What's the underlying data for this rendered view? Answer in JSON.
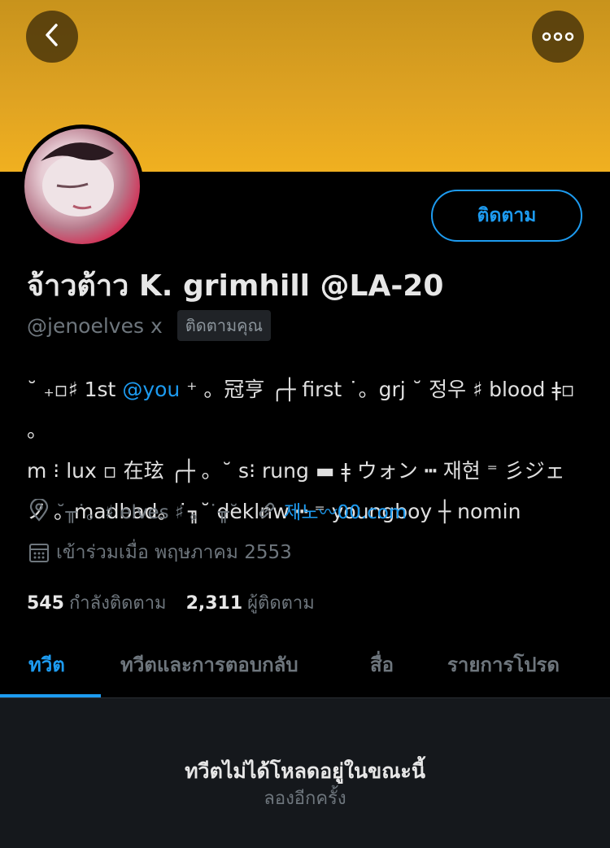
{
  "header": {
    "back_icon": "chevron-left-icon",
    "more_icon": "more-horizontal-icon",
    "banner_color": "#dea222"
  },
  "profile": {
    "follow_label": "ติดตาม",
    "display_name": "จ้าวต้าว K. grimhill @LA-20",
    "handle": "@jenoelves x",
    "follows_you": "ติดตามคุณ",
    "bio": {
      "line1_pre": "˘ ₊▫︎♯ 1st ",
      "line1_mention": "@you",
      "line1_post": " ⁺ 。冠亨 ╭┼ first ˙。grj ˘ 정우 ♯ blood ǂ▫︎ 。",
      "line2": "m ⁝ lux ▫︎ 在玹 ╭┼ 。˘ s⁝ rung ▬ ǂ ウォン ┅ 재현 ⁼ 彡ジェ",
      "line3": "ノ 。madbad。˙╖˘ deklnw ┅ ⁼ youngboy ┼ nomin"
    },
    "location": "˘╥˙。♯ elves ♯ 。˙╥˘",
    "website": "제노〰00.com",
    "joined": "เข้าร่วมเมื่อ พฤษภาคม 2553",
    "following_count": "545",
    "following_label": "กำลังติดตาม",
    "followers_count": "2,311",
    "followers_label": "ผู้ติดตาม",
    "accent_color": "#1d9bf0"
  },
  "tabs": [
    {
      "label": "ทวีต",
      "active": true
    },
    {
      "label": "ทวีตและการตอบกลับ",
      "active": false
    },
    {
      "label": "สื่อ",
      "active": false
    },
    {
      "label": "รายการโปรด",
      "active": false
    }
  ],
  "content": {
    "error_title": "ทวีตไม่ได้โหลดอยู่ในขณะนี้",
    "error_subtitle": "ลองอีกครั้ง"
  }
}
